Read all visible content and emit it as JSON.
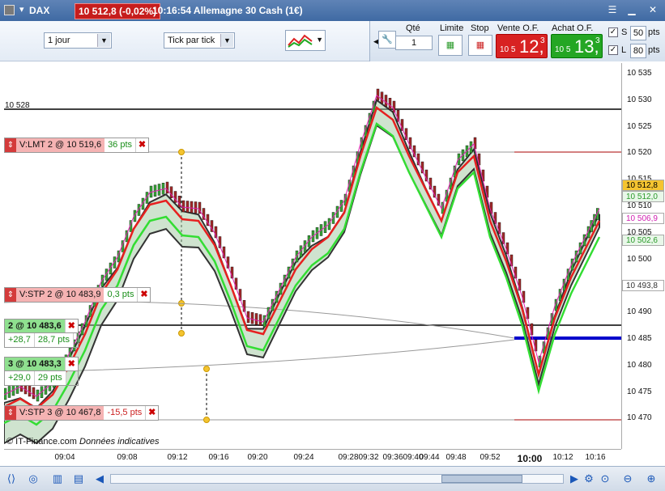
{
  "window": {
    "instrument": "DAX",
    "last_price": "10 512,8 (-0,02%)",
    "time_title": "10:16:54 Allemagne 30 Cash (1€)"
  },
  "toolbar": {
    "period": "1 jour",
    "tick_mode": "Tick par tick",
    "qty_label": "Qté",
    "qty_value": "1",
    "limit_label": "Limite",
    "stop_label": "Stop",
    "sell_label": "Vente O.F.",
    "buy_label": "Achat O.F.",
    "sell_small": "10 5",
    "sell_big": "12,",
    "sell_sup": "3",
    "buy_small": "10 5",
    "buy_big": "13,",
    "buy_sup": "3",
    "s_label": "S",
    "s_value": "50",
    "l_label": "L",
    "l_value": "80",
    "pts": "pts"
  },
  "chart": {
    "level_label": "10 528",
    "credit_source": "© IT-Finance.com",
    "credit_note": "Données indicatives",
    "y_ticks": [
      "10 535",
      "10 530",
      "10 525",
      "10 520",
      "10 515",
      "10 510",
      "10 505",
      "10 500",
      "10 495",
      "10 490",
      "10 485",
      "10 480",
      "10 475",
      "10 470"
    ],
    "x_ticks": [
      "09:04",
      "09:08",
      "09:12",
      "09:16",
      "09:20",
      "09:24",
      "09:28",
      "09:32",
      "09:36",
      "09:40",
      "09:44",
      "09:48",
      "09:52",
      "10:00",
      "10:12",
      "10:16"
    ],
    "y_badges": [
      {
        "label": "10 512,8",
        "bg": "#f4c430",
        "color": "#000"
      },
      {
        "label": "10 512,0",
        "bg": "#e9f7e9",
        "color": "#2a9a2a"
      },
      {
        "label": "10 506,9",
        "bg": "#fff",
        "color": "#d01fb0"
      },
      {
        "label": "10 502,6",
        "bg": "#e9f7e9",
        "color": "#2a9a2a"
      },
      {
        "label": "10 493,8",
        "bg": "#fff",
        "color": "#333"
      }
    ],
    "orders": [
      {
        "main": "V:LMT 2 @ 10 519,6",
        "pts": "36 pts"
      },
      {
        "main": "V:STP 2 @ 10 483,9",
        "pts": "0,3 pts"
      },
      {
        "main": "V:STP 3 @ 10 467,8",
        "pts": "-15,5 pts"
      }
    ],
    "positions": [
      {
        "main": "2 @ 10 483,6",
        "pl": "+28,7",
        "pts": "28,7 pts"
      },
      {
        "main": "3 @ 10 483,3",
        "pl": "+29,0",
        "pts": "29 pts"
      }
    ]
  },
  "colors": {
    "accent": "#3f6aa3",
    "sell": "#d82222",
    "buy": "#24a624",
    "ma_fast": "#e62020",
    "ma_slow": "#33dd33"
  }
}
